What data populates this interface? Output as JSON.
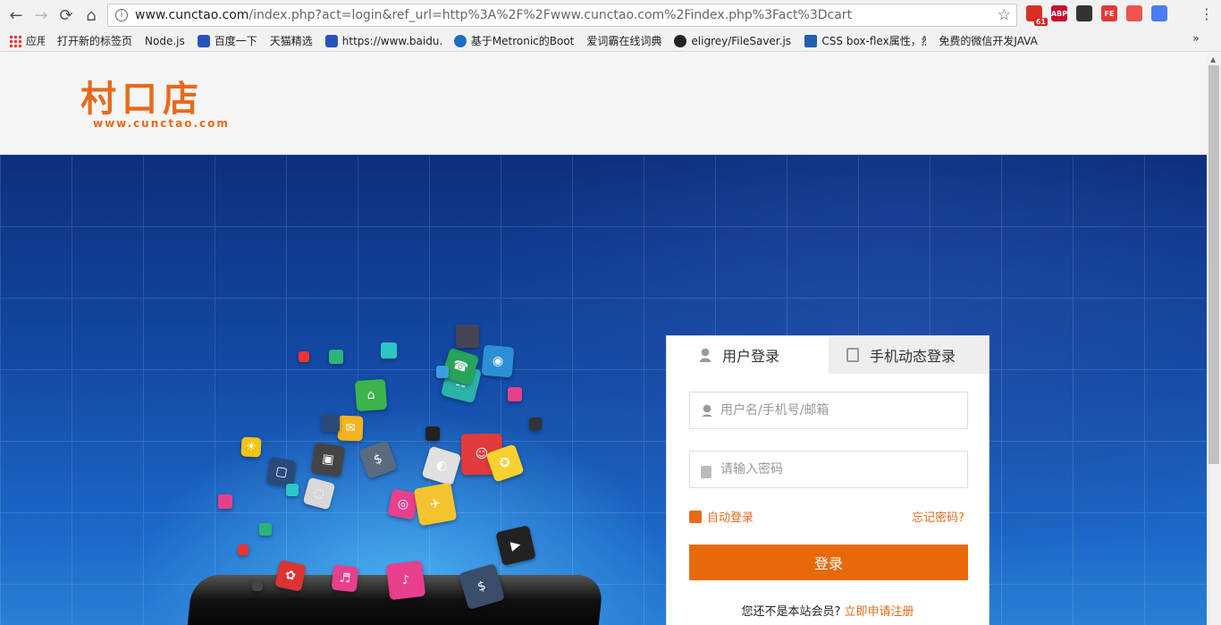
{
  "browser": {
    "url_host": "www.cunctao.com",
    "url_path": "/index.php?act=login&ref_url=http%3A%2F%2Fwww.cunctao.com%2Findex.php%3Fact%3Dcart",
    "extensions": [
      {
        "name": "gmail-extension",
        "label": "",
        "badge": "61",
        "color": "#d93025"
      },
      {
        "name": "adblock-plus",
        "label": "ABP",
        "color": "#c70d2c"
      },
      {
        "name": "qr-code",
        "label": "",
        "color": "#333333"
      },
      {
        "name": "fe-helper",
        "label": "FE",
        "color": "#e53935"
      },
      {
        "name": "settings-extension",
        "label": "",
        "color": "#ef5350"
      },
      {
        "name": "google-translate",
        "label": "",
        "color": "#4a7cf5"
      }
    ],
    "bookmarks": [
      {
        "label": "应用",
        "icon": "apps-icon"
      },
      {
        "label": "打开新的标签页",
        "icon": "page-icon"
      },
      {
        "label": "Node.js",
        "icon": "page-icon"
      },
      {
        "label": "百度一下",
        "icon": "paw-icon"
      },
      {
        "label": "天猫精选",
        "icon": "page-icon"
      },
      {
        "label": "https://www.baidu.c",
        "icon": "paw-icon"
      },
      {
        "label": "基于Metronic的Boot",
        "icon": "twitter-bootstrap-icon"
      },
      {
        "label": "爱词霸在线词典",
        "icon": "page-icon"
      },
      {
        "label": "eligrey/FileSaver.js: /",
        "icon": "github-icon"
      },
      {
        "label": "CSS box-flex属性，然",
        "icon": "css-icon"
      },
      {
        "label": "免费的微信开发JAVA",
        "icon": "page-icon"
      }
    ],
    "more": "»"
  },
  "site": {
    "logo_title": "村口店",
    "logo_sub": "www.cunctao.com"
  },
  "login": {
    "tab_user": "用户登录",
    "tab_mobile": "手机动态登录",
    "username_placeholder": "用户名/手机号/邮箱",
    "password_placeholder": "请输入密码",
    "auto_login": "自动登录",
    "forgot": "忘记密码?",
    "submit": "登录",
    "not_member": "您还不是本站会员?",
    "register": "立即申请注册"
  },
  "hero_tiles": [
    {
      "glyph": "$",
      "color": "#5a6b80"
    },
    {
      "glyph": "◐",
      "color": "#e0e0e0"
    },
    {
      "glyph": "☷",
      "color": "#2bb3a8"
    },
    {
      "glyph": "◎",
      "color": "#e8408c"
    },
    {
      "glyph": "▣",
      "color": "#444"
    },
    {
      "glyph": "◉",
      "color": "#2d8fd6"
    },
    {
      "glyph": "✉",
      "color": "#f4b320"
    },
    {
      "glyph": "☺",
      "color": "#e23b3b"
    },
    {
      "glyph": "⌂",
      "color": "#3cb44b"
    },
    {
      "glyph": "♪",
      "color": "#e8408c"
    },
    {
      "glyph": "✈",
      "color": "#f4c430"
    },
    {
      "glyph": "▶",
      "color": "#222"
    },
    {
      "glyph": "$",
      "color": "#3a4e6a"
    },
    {
      "glyph": "✪",
      "color": "#f7d12f"
    },
    {
      "glyph": "☎",
      "color": "#28a35a"
    },
    {
      "glyph": "◌",
      "color": "#d8d8d8"
    },
    {
      "glyph": "✿",
      "color": "#d33"
    },
    {
      "glyph": "▢",
      "color": "#2b4a7a"
    },
    {
      "glyph": "♬",
      "color": "#e8408c"
    },
    {
      "glyph": "☀",
      "color": "#f1c40f"
    }
  ]
}
